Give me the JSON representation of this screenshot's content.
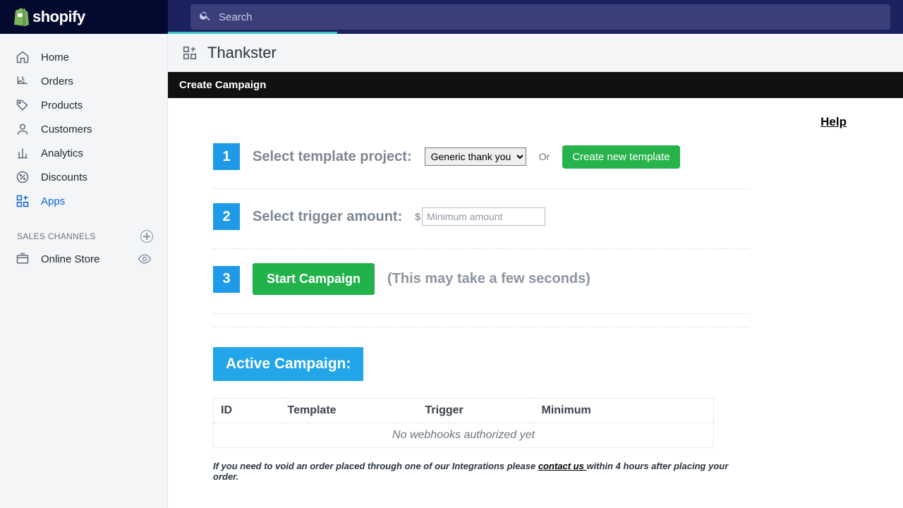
{
  "brand": {
    "name": "shopify"
  },
  "search": {
    "placeholder": "Search"
  },
  "sidebar": {
    "items": [
      {
        "label": "Home",
        "icon": "home-icon"
      },
      {
        "label": "Orders",
        "icon": "orders-icon"
      },
      {
        "label": "Products",
        "icon": "tag-icon"
      },
      {
        "label": "Customers",
        "icon": "person-icon"
      },
      {
        "label": "Analytics",
        "icon": "chart-icon"
      },
      {
        "label": "Discounts",
        "icon": "discount-icon"
      },
      {
        "label": "Apps",
        "icon": "apps-icon",
        "active": true
      }
    ],
    "section_label": "SALES CHANNELS",
    "channels": [
      {
        "label": "Online Store",
        "icon": "store-icon"
      }
    ]
  },
  "page": {
    "app_title": "Thankster",
    "bar_title": "Create Campaign",
    "help": "Help"
  },
  "steps": {
    "s1": {
      "num": "1",
      "label": "Select template project:",
      "selected": "Generic thank you",
      "or": "Or",
      "create": "Create new template"
    },
    "s2": {
      "num": "2",
      "label": "Select trigger amount:",
      "currency": "$",
      "placeholder": "Minimum amount"
    },
    "s3": {
      "num": "3",
      "button": "Start Campaign",
      "note": "(This may take a few seconds)"
    }
  },
  "active": {
    "title": "Active Campaign:",
    "cols": [
      "ID",
      "Template",
      "Trigger",
      "Minimum"
    ],
    "empty": "No webhooks authorized yet"
  },
  "footnote": {
    "pre": "If you need to void an order placed through one of our Integrations please ",
    "link": "contact us ",
    "post": "within 4 hours after placing your order."
  }
}
